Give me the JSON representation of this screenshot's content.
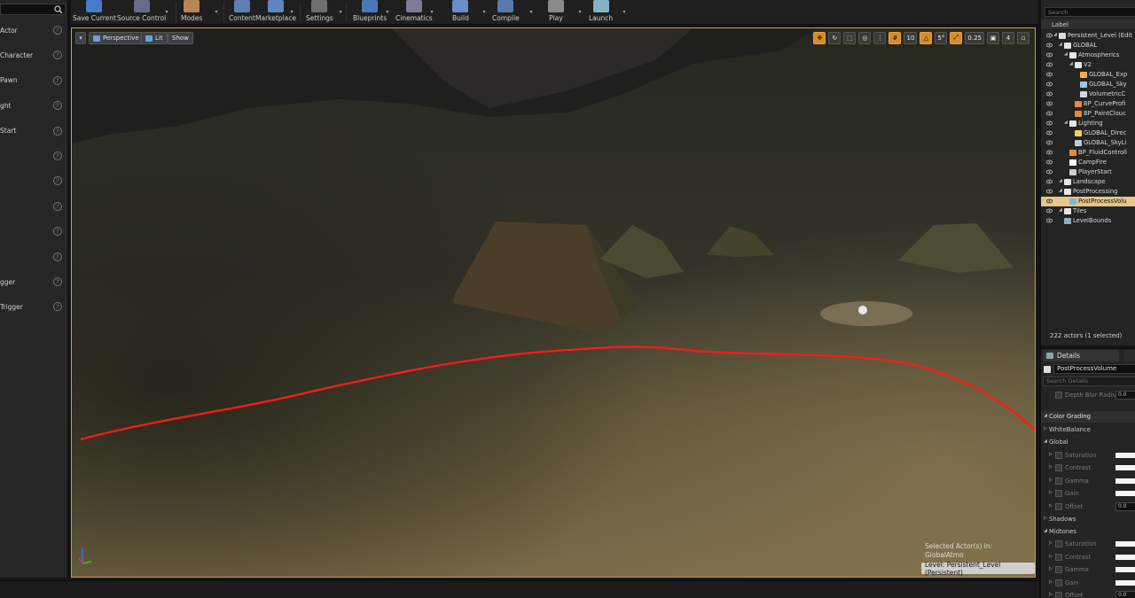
{
  "toolbar": {
    "items": [
      {
        "label": "Save Current",
        "icon": "save-icon"
      },
      {
        "label": "Source Control",
        "icon": "source-control-icon"
      },
      {
        "label": "Modes",
        "icon": "modes-icon"
      },
      {
        "label": "Content",
        "icon": "content-icon"
      },
      {
        "label": "Marketplace",
        "icon": "marketplace-icon"
      },
      {
        "label": "Settings",
        "icon": "settings-icon"
      },
      {
        "label": "Blueprints",
        "icon": "blueprints-icon"
      },
      {
        "label": "Cinematics",
        "icon": "cinematics-icon"
      },
      {
        "label": "Build",
        "icon": "build-icon"
      },
      {
        "label": "Compile",
        "icon": "compile-icon"
      },
      {
        "label": "Play",
        "icon": "play-icon"
      },
      {
        "label": "Launch",
        "icon": "launch-icon"
      }
    ]
  },
  "left_panel": {
    "items": [
      "Actor",
      "Character",
      "Pawn",
      "ght",
      "Start",
      "",
      "",
      "",
      "",
      "",
      "gger",
      "Trigger"
    ]
  },
  "viewport": {
    "perspective_label": "Perspective",
    "lit_label": "Lit",
    "show_label": "Show",
    "grid_snap": "5°",
    "scale_snap": "0.25",
    "camera_speed": "4",
    "selected_actor_line1": "Selected Actor(s) in:",
    "selected_actor_line2": "GlobalAtmo",
    "level_label": "Level:  Persistent_Level (Persistent)"
  },
  "outliner": {
    "search_placeholder": "Search",
    "column_label": "Label",
    "rows": [
      {
        "label": "Persistent_Level (Edit",
        "selected": false
      },
      {
        "label": "GLOBAL",
        "selected": false
      },
      {
        "label": "Atmospherics",
        "selected": false
      },
      {
        "label": "V2",
        "selected": false
      },
      {
        "label": "GLOBAL_Exp",
        "selected": false
      },
      {
        "label": "GLOBAL_Sky",
        "selected": false
      },
      {
        "label": "VolumetricC",
        "selected": false
      },
      {
        "label": "BP_CurveProfi",
        "selected": false
      },
      {
        "label": "BP_PaintClouc",
        "selected": false
      },
      {
        "label": "Lighting",
        "selected": false
      },
      {
        "label": "GLOBAL_Direc",
        "selected": false
      },
      {
        "label": "GLOBAL_SkyLi",
        "selected": false
      },
      {
        "label": "BP_FluidControll",
        "selected": false
      },
      {
        "label": "CampFire",
        "selected": false
      },
      {
        "label": "PlayerStart",
        "selected": false
      },
      {
        "label": "Landscape",
        "selected": false
      },
      {
        "label": "PostProcessing",
        "selected": false
      },
      {
        "label": "PostProcessVolu",
        "selected": true
      },
      {
        "label": "Tiles",
        "selected": false
      },
      {
        "label": "LevelBounds",
        "selected": false
      }
    ],
    "actor_count": "222 actors (1 selected)"
  },
  "details": {
    "tab_label": "Details",
    "object_name": "PostProcessVolume",
    "search_placeholder": "Search Details",
    "rows": [
      {
        "label": "Depth Blur Radius",
        "kind": "value",
        "value": "0.0"
      },
      {
        "label": "Color Grading",
        "kind": "section"
      },
      {
        "label": "WhiteBalance",
        "kind": "group"
      },
      {
        "label": "Global",
        "kind": "group"
      },
      {
        "label": "Saturation",
        "kind": "bar"
      },
      {
        "label": "Contrast",
        "kind": "bar"
      },
      {
        "label": "Gamma",
        "kind": "bar"
      },
      {
        "label": "Gain",
        "kind": "bar"
      },
      {
        "label": "Offset",
        "kind": "value",
        "value": "0.0"
      },
      {
        "label": "Shadows",
        "kind": "group"
      },
      {
        "label": "Midtones",
        "kind": "group"
      },
      {
        "label": "Saturation",
        "kind": "bar"
      },
      {
        "label": "Contrast",
        "kind": "bar"
      },
      {
        "label": "Gamma",
        "kind": "bar"
      },
      {
        "label": "Gain",
        "kind": "bar"
      },
      {
        "label": "Offset",
        "kind": "value",
        "value": "0.0"
      }
    ]
  },
  "colors": {
    "selection": "#e6c48a",
    "accent_orange": "#d78a2a",
    "annotation_line": "#ff1a1a",
    "viewport_border": "#c8a03a"
  }
}
